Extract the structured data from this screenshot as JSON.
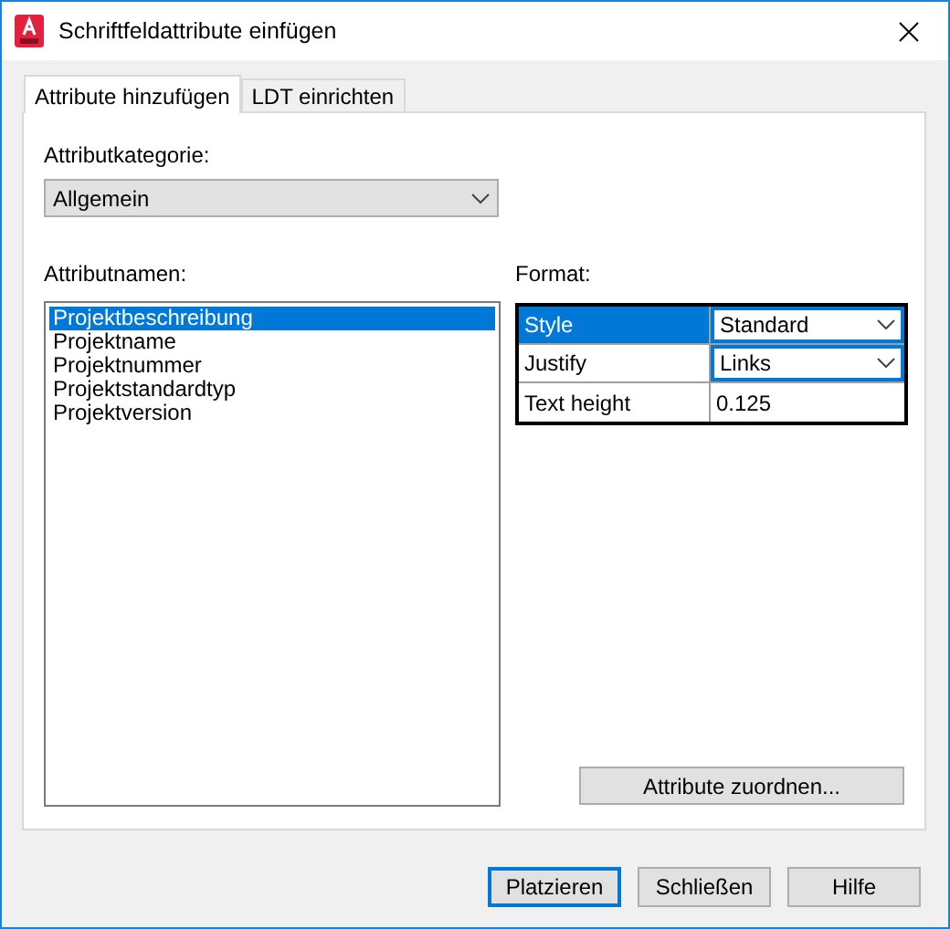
{
  "window": {
    "title": "Schriftfeldattribute einfügen"
  },
  "tabs": [
    {
      "label": "Attribute hinzufügen",
      "selected": true
    },
    {
      "label": "LDT einrichten",
      "selected": false
    }
  ],
  "category": {
    "label": "Attributkategorie:",
    "value": "Allgemein"
  },
  "names": {
    "label": "Attributnamen:",
    "items": [
      {
        "text": "Projektbeschreibung",
        "selected": true
      },
      {
        "text": "Projektname",
        "selected": false
      },
      {
        "text": "Projektnummer",
        "selected": false
      },
      {
        "text": "Projektstandardtyp",
        "selected": false
      },
      {
        "text": "Projektversion",
        "selected": false
      }
    ]
  },
  "format": {
    "label": "Format:",
    "rows": [
      {
        "name": "Style",
        "value": "Standard",
        "kind": "dropdown",
        "selected": true
      },
      {
        "name": "Justify",
        "value": "Links",
        "kind": "dropdown",
        "selected": false
      },
      {
        "name": "Text height",
        "value": "0.125",
        "kind": "text",
        "selected": false
      }
    ]
  },
  "map_button": "Attribute zuordnen...",
  "buttons": [
    {
      "label": "Platzieren",
      "default": true
    },
    {
      "label": "Schließen",
      "default": false
    },
    {
      "label": "Hilfe",
      "default": false
    }
  ]
}
